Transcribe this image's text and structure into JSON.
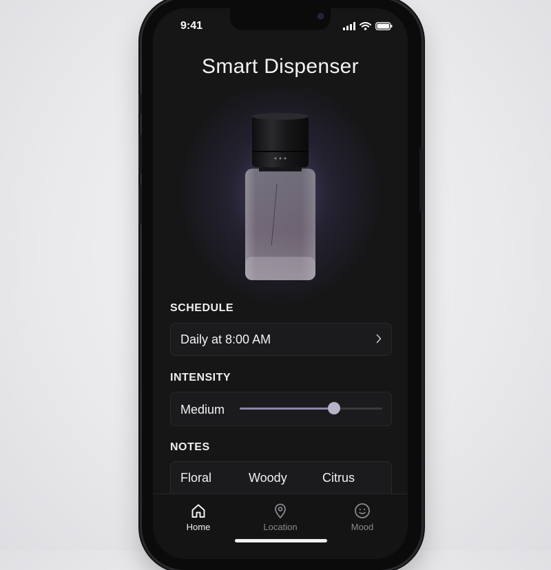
{
  "status_bar": {
    "time": "9:41"
  },
  "header": {
    "title": "Smart Dispenser"
  },
  "product": {
    "image": "perfume-bottle"
  },
  "schedule": {
    "label": "SCHEDULE",
    "value": "Daily at 8:00 AM",
    "icon": "chevron-right-icon"
  },
  "intensity": {
    "label": "INTENSITY",
    "value_label": "Medium",
    "level": 0.66
  },
  "notes": {
    "label": "NOTES",
    "items": [
      "Floral",
      "Woody",
      "Citrus"
    ]
  },
  "tabbar": {
    "tabs": [
      {
        "label": "Home",
        "icon": "home-icon",
        "active": true
      },
      {
        "label": "Location",
        "icon": "location-pin-icon",
        "active": false
      },
      {
        "label": "Mood",
        "icon": "smiley-icon",
        "active": false
      }
    ]
  },
  "colors": {
    "screen_bg": "#161617",
    "accent": "#8d86ad",
    "text_primary": "#f2f2f4",
    "text_inactive": "#8a8a8f"
  }
}
